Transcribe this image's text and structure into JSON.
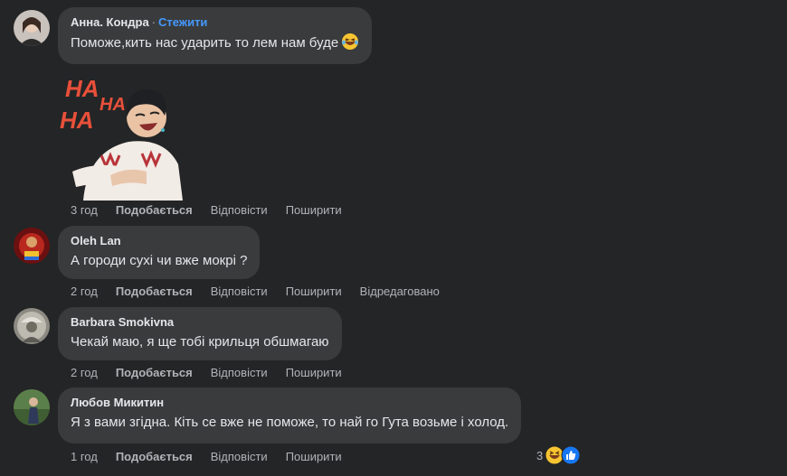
{
  "comments": [
    {
      "author": "Анна. Кондра",
      "follow_label": "Стежити",
      "separator": "·",
      "text": "Поможе,кить нас ударить то лем нам буде",
      "text_emoji": "laughing-tears-emoji",
      "sticker": "haha-laughing-sticker",
      "sticker_text": [
        "HA",
        "HA",
        "HA"
      ],
      "time": "3 год",
      "like": "Подобається",
      "reply": "Відповісти",
      "share": "Поширити"
    },
    {
      "author": "Oleh Lan",
      "text": "А городи сухі чи вже мокрі ?",
      "time": "2 год",
      "like": "Подобається",
      "reply": "Відповісти",
      "share": "Поширити",
      "edited": "Відредаговано"
    },
    {
      "author": "Barbara Smokivna",
      "text": "Чекай маю, я ще тобі крильця обшмагаю",
      "time": "2 год",
      "like": "Подобається",
      "reply": "Відповісти",
      "share": "Поширити"
    },
    {
      "author": "Любов Микитин",
      "text": "Я з вами згідна. Кіть се вже не поможе, то най го Гута возьме і холод.",
      "time": "1 год",
      "like": "Подобається",
      "reply": "Відповісти",
      "share": "Поширити",
      "reaction_count": "3",
      "reaction_icons": [
        "laughing-emoji",
        "like-thumb-icon"
      ]
    }
  ],
  "colors": {
    "background": "#242526",
    "bubble": "#3a3b3c",
    "text": "#e4e6eb",
    "muted": "#b0b3b8",
    "follow": "#4599ff"
  }
}
